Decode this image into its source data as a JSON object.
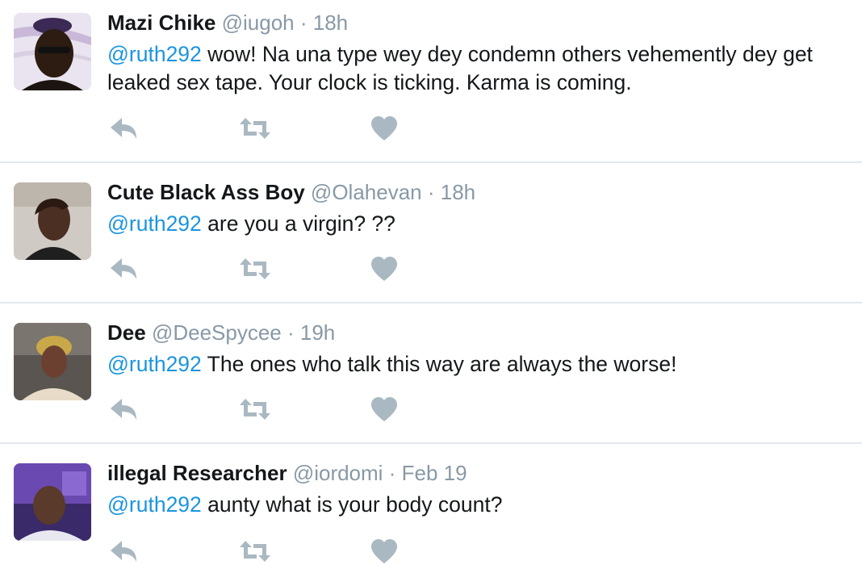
{
  "tweets": [
    {
      "name": "Mazi Chike",
      "handle": "@iugoh",
      "separator": "·",
      "time": "18h",
      "mention": "@ruth292",
      "text": " wow! Na una type wey dey condemn others vehemently dey get leaked sex tape. Your clock is ticking. Karma is coming."
    },
    {
      "name": "Cute Black Ass Boy",
      "handle": "@Olahevan",
      "separator": "·",
      "time": "18h",
      "mention": "@ruth292",
      "text": " are you a virgin? ??"
    },
    {
      "name": "Dee",
      "handle": "@DeeSpycee",
      "separator": "·",
      "time": "19h",
      "mention": "@ruth292",
      "text": " The ones who talk this way are always the worse!"
    },
    {
      "name": "illegal Researcher",
      "handle": "@iordomi",
      "separator": "·",
      "time": "Feb 19",
      "mention": "@ruth292",
      "text": " aunty what is your body count?"
    }
  ],
  "icons": {
    "reply": "reply-icon",
    "retweet": "retweet-icon",
    "like": "heart-icon"
  },
  "colors": {
    "text": "#14171a",
    "secondary": "#8899a6",
    "mention": "#1b95e0",
    "icon": "#aab8c2",
    "divider": "#e1e8ed"
  }
}
